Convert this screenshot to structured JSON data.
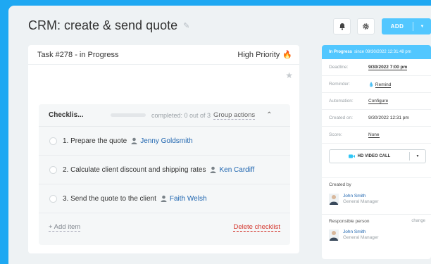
{
  "page": {
    "title": "CRM: create & send quote"
  },
  "toolbar": {
    "add_label": "ADD"
  },
  "task": {
    "header": "Task #278 - in Progress",
    "priority": "High Priority"
  },
  "checklist": {
    "title": "Checklis...",
    "completed": "completed: 0 out of 3",
    "progress_fraction": 0,
    "group_actions": "Group actions",
    "items": [
      {
        "text": "1. Prepare the quote",
        "assignee": "Jenny Goldsmith"
      },
      {
        "text": "2. Calculate client discount and shipping rates",
        "assignee": "Ken Cardiff"
      },
      {
        "text": "3. Send the quote to the client",
        "assignee": "Faith Welsh"
      }
    ],
    "add_item": "+ Add item",
    "delete": "Delete checklist"
  },
  "sidebar": {
    "status": "In Progress",
    "status_since": "since 09/30/2022 12:31:48 pm",
    "fields": {
      "deadline": {
        "label": "Deadline:",
        "value": "9/30/2022 7:00 pm"
      },
      "reminder": {
        "label": "Reminder:",
        "value": "Remind"
      },
      "automation": {
        "label": "Automation:",
        "value": "Configure"
      },
      "created_on": {
        "label": "Created on:",
        "value": "9/30/2022 12:31 pm"
      },
      "score": {
        "label": "Score:",
        "value": "None"
      }
    },
    "video_button": "HD VIDEO CALL",
    "created_by": {
      "label": "Created by",
      "name": "John Smith",
      "role": "General Manager"
    },
    "responsible": {
      "label": "Responsible person",
      "change": "change",
      "name": "John Smith",
      "role": "General Manager"
    }
  },
  "colors": {
    "background": "#1ea8f2",
    "accent": "#52c7ff",
    "link": "#2066b0",
    "danger": "#d3342b"
  }
}
